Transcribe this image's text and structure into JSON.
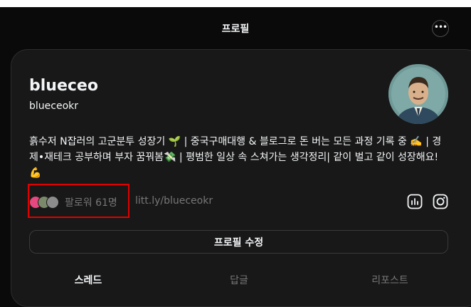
{
  "header": {
    "title": "프로필"
  },
  "profile": {
    "name": "blueceo",
    "handle": "blueceokr",
    "bio": "흙수저 N잡러의 고군분투 성장기 🌱 | 중국구매대행 & 블로그로 돈 버는 모든 과정 기록 중 ✍️ | 경제•재테크 공부하며 부자 꿈꿔봄💸 | 평범한 일상 속 스쳐가는 생각정리| 같이 벌고 같이 성장해요! 💪",
    "followers": "팔로워 61명",
    "link": "litt.ly/blueceokr"
  },
  "actions": {
    "edit_profile": "프로필 수정"
  },
  "tabs": [
    {
      "label": "스레드",
      "active": true
    },
    {
      "label": "답글",
      "active": false
    },
    {
      "label": "리포스트",
      "active": false
    }
  ],
  "icons": [
    "more-icon",
    "insights-icon",
    "instagram-icon"
  ],
  "colors": {
    "background": "#0a0a0a",
    "card": "#181818",
    "text": "#f3f5f7",
    "muted": "#777777",
    "highlight": "#e00000"
  }
}
